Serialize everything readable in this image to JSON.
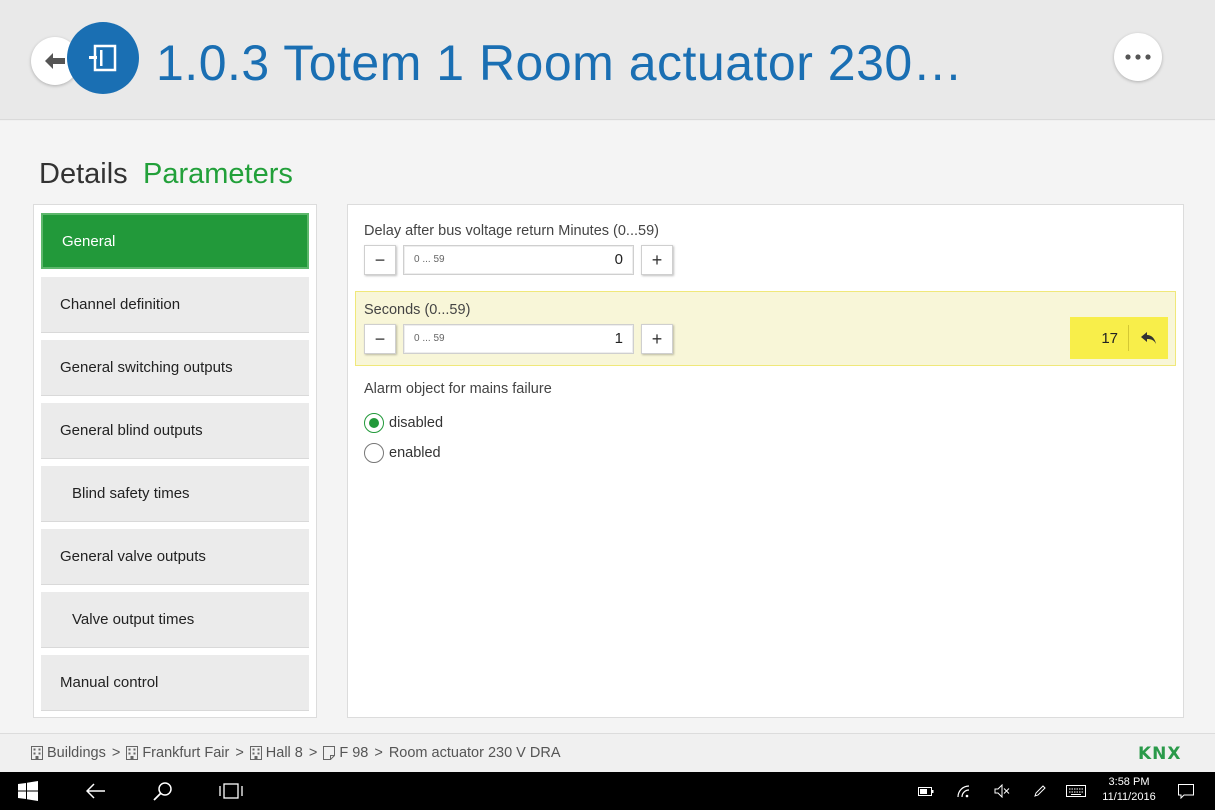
{
  "header": {
    "title": "1.0.3 Totem 1 Room actuator 230…",
    "back_icon": "arrow-left-icon",
    "device_icon": "device-icon",
    "more_icon": "more-dots-icon"
  },
  "tabs": [
    {
      "label": "Details",
      "active": false
    },
    {
      "label": "Parameters",
      "active": true
    }
  ],
  "sidebar": {
    "items": [
      {
        "label": "General",
        "active": true,
        "sub": false
      },
      {
        "label": "Channel definition",
        "active": false,
        "sub": false
      },
      {
        "label": "General switching outputs",
        "active": false,
        "sub": false
      },
      {
        "label": "General blind outputs",
        "active": false,
        "sub": false
      },
      {
        "label": "Blind safety times",
        "active": false,
        "sub": true
      },
      {
        "label": "General valve outputs",
        "active": false,
        "sub": false
      },
      {
        "label": "Valve output times",
        "active": false,
        "sub": true
      },
      {
        "label": "Manual control",
        "active": false,
        "sub": false
      }
    ]
  },
  "params": {
    "minutes": {
      "label": "Delay after bus voltage return Minutes (0...59)",
      "placeholder": "0 ... 59",
      "value": "0",
      "minus": "−",
      "plus": "+"
    },
    "seconds": {
      "label": "Seconds (0...59)",
      "placeholder": "0 ... 59",
      "value": "1",
      "minus": "−",
      "plus": "+",
      "default_value": "17",
      "undo_icon": "undo-arrow-icon"
    },
    "alarm": {
      "label": "Alarm object for mains failure",
      "options": [
        {
          "label": "disabled",
          "checked": true
        },
        {
          "label": "enabled",
          "checked": false
        }
      ]
    }
  },
  "breadcrumb": {
    "items": [
      "Buildings",
      "Frankfurt Fair",
      "Hall 8",
      "F 98",
      "Room actuator 230 V DRA"
    ],
    "separator": ">"
  },
  "brand": {
    "logo_text": "KNX"
  },
  "taskbar": {
    "time": "3:58 PM",
    "date": "11/11/2016"
  },
  "colors": {
    "accent_blue": "#1a6fb3",
    "accent_green": "#22993a",
    "highlight_yellow": "#f8ee4a"
  }
}
